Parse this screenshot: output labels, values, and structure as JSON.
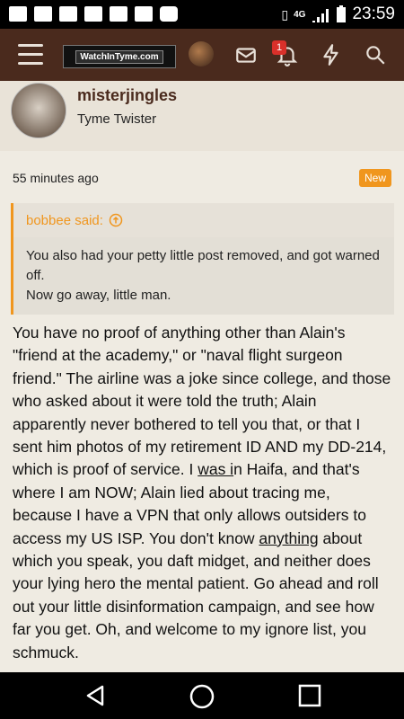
{
  "status_bar": {
    "network": "4G",
    "time": "23:59"
  },
  "app_bar": {
    "logo_text": "WatchInTyme.com",
    "notification_count": "1"
  },
  "profile": {
    "username": "misterjingles",
    "user_title": "Tyme Twister"
  },
  "post": {
    "timestamp": "55 minutes ago",
    "new_badge": "New",
    "quote": {
      "author": "bobbee said:",
      "lines": [
        "You also had your petty little post removed, and got warned off.",
        "Now go away, little man."
      ]
    },
    "body": {
      "p1": "You have no proof of anything other than Alain's \"friend at the academy,\" or \"naval flight surgeon friend.\" The airline was a joke since college, and those who asked about it were told the truth; Alain apparently never bothered to tell you that, or that I sent him photos of my retirement ID AND my DD-214, which is proof of service. I ",
      "u1": "was i",
      "p2": "n Haifa, and that's where I am NOW; Alain lied about tracing me, because I have a VPN that only allows outsiders to access my US ISP. You don't know ",
      "u2": "anything",
      "p3": " about which you speak, you daft midget, and neither does your lying hero the mental patient. Go ahead and roll out your little disinformation campaign, and see how far you get. Oh, and welcome to my ignore list, you schmuck."
    }
  },
  "icons": [
    "menu-icon",
    "envelope-icon",
    "bell-icon",
    "bolt-icon",
    "search-icon",
    "back-icon",
    "home-icon",
    "recents-icon"
  ]
}
